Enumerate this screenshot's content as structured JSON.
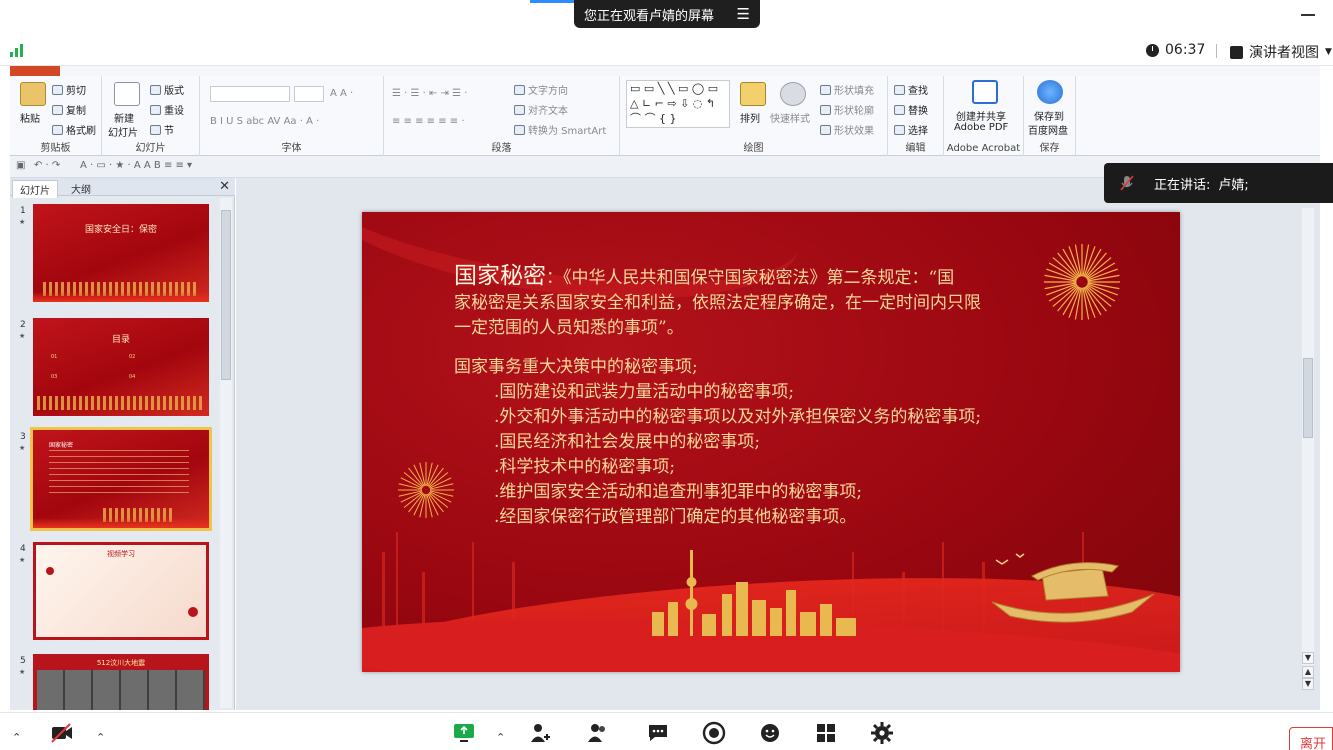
{
  "meeting": {
    "share_banner": "您正在观看卢婧的屏幕",
    "time": "06:37",
    "presenter_view": "演讲者视图",
    "speaking_label": "正在讲话:",
    "speaker_name": "卢婧;",
    "leave_label": "离开"
  },
  "ribbon": {
    "clipboard": {
      "paste": "粘贴",
      "cut": "剪切",
      "copy": "复制",
      "format_painter": "格式刷",
      "label": "剪贴板"
    },
    "slides": {
      "new_slide": "新建",
      "new_slide_2": "幻灯片",
      "layout": "版式",
      "reset": "重设",
      "section": "节",
      "label": "幻灯片"
    },
    "font": {
      "label": "字体"
    },
    "paragraph": {
      "text_direction": "文字方向",
      "align_text": "对齐文本",
      "convert_smartart": "转换为 SmartArt",
      "label": "段落"
    },
    "drawing": {
      "arrange": "排列",
      "quick_styles": "快速样式",
      "shape_fill": "形状填充",
      "shape_outline": "形状轮廓",
      "shape_effects": "形状效果",
      "label": "绘图"
    },
    "editing": {
      "find": "查找",
      "replace": "替换",
      "select": "选择",
      "label": "编辑"
    },
    "acrobat": {
      "create_share": "创建并共享",
      "adobe_pdf": "Adobe PDF",
      "label": "Adobe Acrobat"
    },
    "save": {
      "save_to": "保存到",
      "baidu": "百度网盘",
      "label": "保存"
    }
  },
  "pane": {
    "tab_slides": "幻灯片",
    "tab_outline": "大纲",
    "thumbnails": [
      {
        "num": "1",
        "title": "国家安全日：保密"
      },
      {
        "num": "2",
        "title": "目录",
        "items": [
          "01",
          "02",
          "03",
          "04"
        ]
      },
      {
        "num": "3",
        "title": "国家秘密"
      },
      {
        "num": "4",
        "title": "视频学习"
      },
      {
        "num": "5",
        "title": "512汶川大地震"
      }
    ]
  },
  "slide": {
    "heading": "国家秘密",
    "lines": [
      "：《中华人民共和国保守国家秘密法》第二条规定：“国",
      "家秘密是关系国家安全和利益，依照法定程序确定，在一定时间内只限",
      "一定范围的人员知悉的事项”。"
    ],
    "list_title": "国家事务重大决策中的秘密事项;",
    "items": [
      ".国防建设和武装力量活动中的秘密事项;",
      ".外交和外事活动中的秘密事项以及对外承担保密义务的秘密事项;",
      ".国民经济和社会发展中的秘密事项;",
      ".科学技术中的秘密事项;",
      ".维护国家安全活动和追查刑事犯罪中的秘密事项;",
      ".经国家保密行政管理部门确定的其他秘密事项。"
    ]
  },
  "colors": {
    "slide_red": "#9a0710",
    "gold_text": "#f6d89a",
    "accent_blue": "#2d8cff",
    "signal_green": "#22b14c"
  }
}
